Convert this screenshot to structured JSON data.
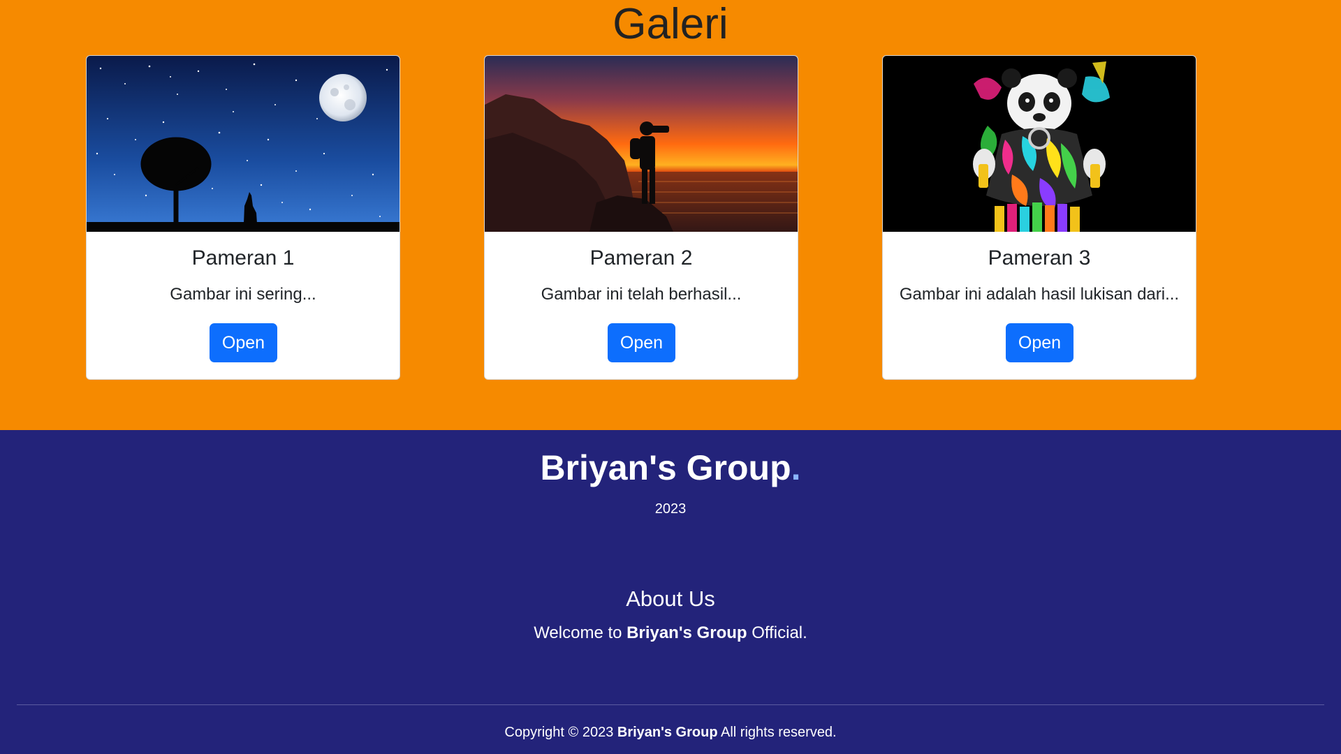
{
  "gallery": {
    "title": "Galeri",
    "background_color": "#f68a00",
    "cards": [
      {
        "image_icon": "night-sky-tree-wolf-image",
        "title": "Pameran 1",
        "text": "Gambar ini sering...",
        "button_label": "Open"
      },
      {
        "image_icon": "sunset-photographer-image",
        "title": "Pameran 2",
        "text": "Gambar ini telah berhasil...",
        "button_label": "Open"
      },
      {
        "image_icon": "graffiti-panda-image",
        "title": "Pameran 3",
        "text": "Gambar ini adalah hasil lukisan dari...",
        "button_label": "Open"
      }
    ]
  },
  "footer": {
    "background_color": "#23237a",
    "brand": "Briyan's Group",
    "brand_dot": ".",
    "year": "2023",
    "about_title": "About Us",
    "about_prefix": "Welcome to ",
    "about_brand": "Briyan's Group",
    "about_suffix": " Official.",
    "copyright_prefix": "Copyright © 2023 ",
    "copyright_brand": "Briyan's Group",
    "copyright_suffix": " All rights reserved."
  },
  "colors": {
    "button": "#0d6efd",
    "accent_dot": "#8ab4ff"
  }
}
